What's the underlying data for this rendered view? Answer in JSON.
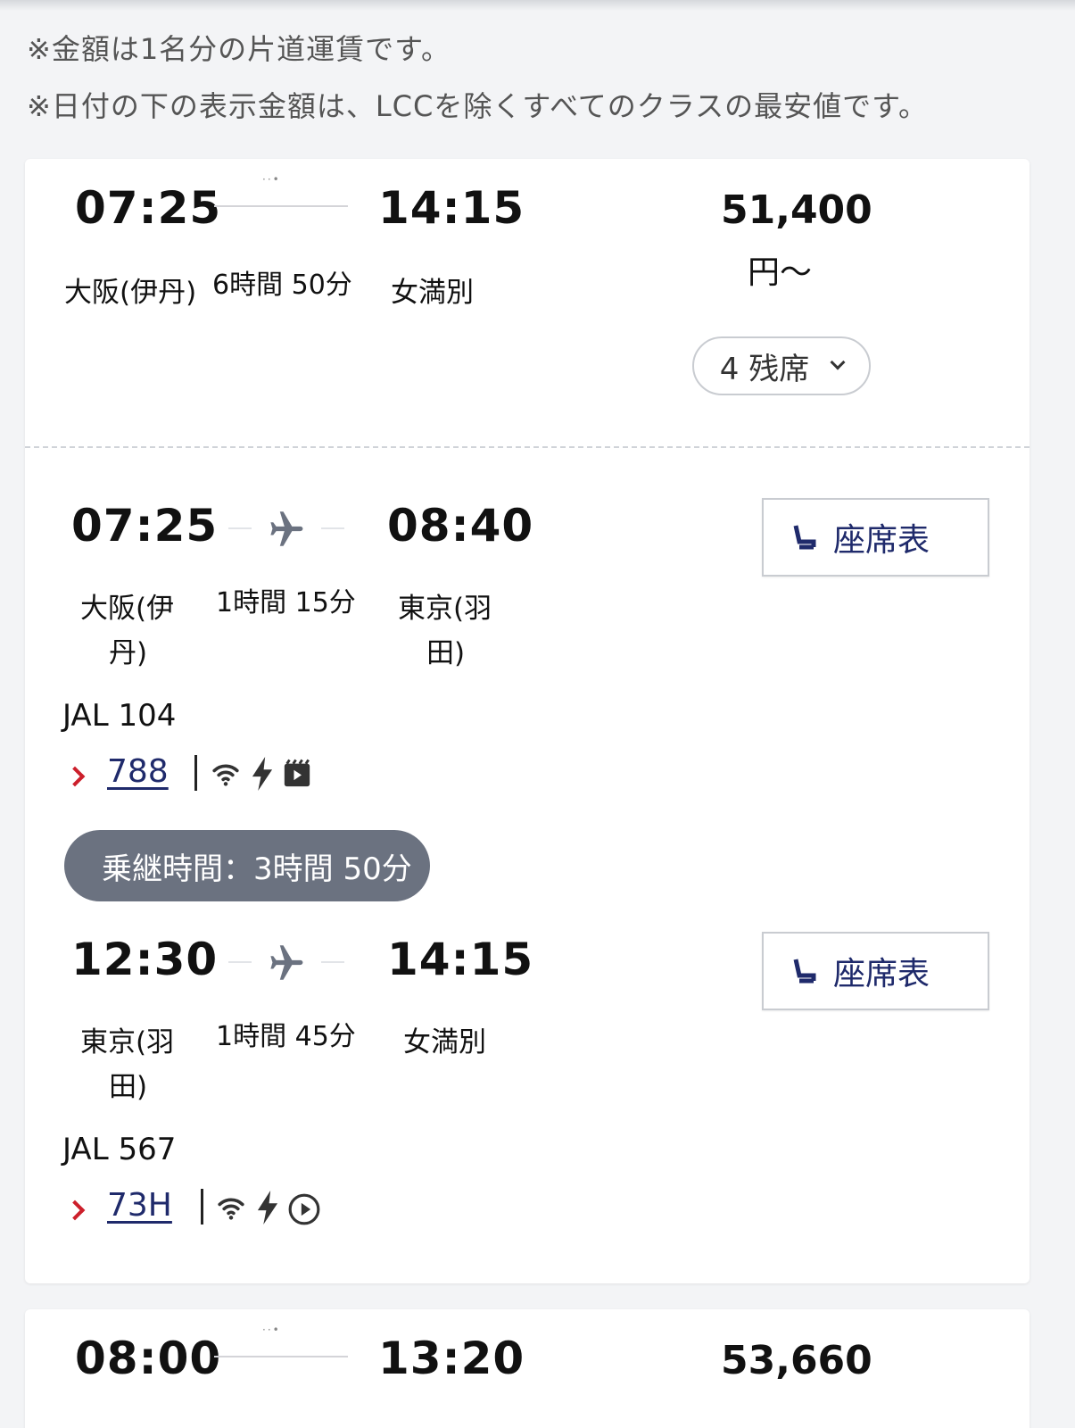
{
  "notes": [
    "※金額は1名分の片道運賃です。",
    "※日付の下の表示金額は、LCCを除くすべてのクラスの最安値です。"
  ],
  "option1": {
    "summary": {
      "depart_time": "07:25",
      "arrive_time": "14:15",
      "depart_city": "大阪(伊丹)",
      "arrive_city": "女満別",
      "duration": "6時間 50分",
      "stops_indicator": "··•",
      "price": "51,400",
      "price_suffix": "円〜",
      "seats_left": "4 残席"
    },
    "segments": [
      {
        "depart_time": "07:25",
        "arrive_time": "08:40",
        "depart_city_l1": "大阪(伊",
        "depart_city_l2": "丹)",
        "arrive_city_l1": "東京(羽",
        "arrive_city_l2": "田)",
        "duration": "1時間 15分",
        "flight_no": "JAL  104",
        "aircraft": "788",
        "seatmap_label": "座席表"
      },
      {
        "depart_time": "12:30",
        "arrive_time": "14:15",
        "depart_city_l1": "東京(羽",
        "depart_city_l2": "田)",
        "arrive_city_l1": "女満別",
        "arrive_city_l2": "",
        "duration": "1時間 45分",
        "flight_no": "JAL  567",
        "aircraft": "73H",
        "seatmap_label": "座席表"
      }
    ],
    "transfer_label": "乗継時間：3時間 50分"
  },
  "option2": {
    "summary": {
      "depart_time": "08:00",
      "arrive_time": "13:20",
      "stops_indicator": "··•",
      "price": "53,660"
    }
  },
  "colors": {
    "link_navy": "#1f2a6b",
    "chevron_red": "#cc1f2b",
    "transfer_pill": "#6b7280",
    "background": "#f3f4f6"
  },
  "icons": {
    "segment1_amenities": [
      "wifi-icon",
      "power-icon",
      "video-icon"
    ],
    "segment2_amenities": [
      "wifi-icon",
      "power-icon",
      "play-icon"
    ]
  }
}
